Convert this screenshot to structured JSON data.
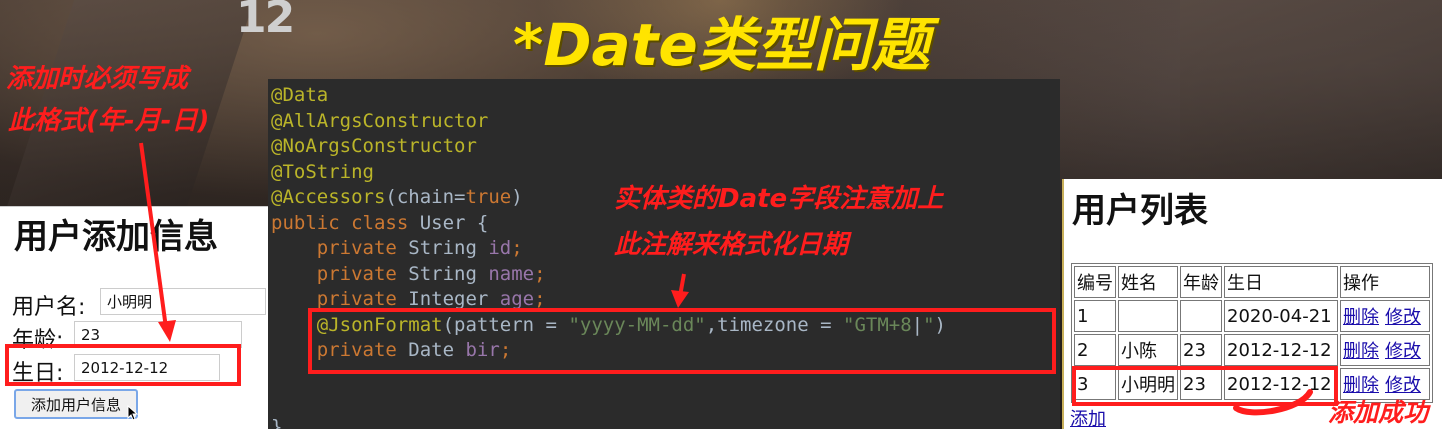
{
  "slide": {
    "page_number": "12",
    "title": "*Date类型问题"
  },
  "annotations": {
    "form_note_line1": "添加时必须写成",
    "form_note_line2": "此格式(年-月-日)",
    "code_note_line1": "实体类的Date字段注意加上",
    "code_note_line2": "此注解来格式化日期",
    "success_note": "添加成功"
  },
  "form": {
    "heading": "用户添加信息",
    "fields": [
      {
        "label": "用户名:",
        "value": "小明明"
      },
      {
        "label": "年龄:",
        "value": "23"
      },
      {
        "label": "生日:",
        "value": "2012-12-12"
      }
    ],
    "submit_label": "添加用户信息"
  },
  "code": {
    "lines": [
      {
        "parts": [
          {
            "t": "@Data",
            "c": "ann"
          }
        ]
      },
      {
        "parts": [
          {
            "t": "@AllArgsConstructor",
            "c": "ann"
          }
        ]
      },
      {
        "parts": [
          {
            "t": "@NoArgsConstructor",
            "c": "ann"
          }
        ]
      },
      {
        "parts": [
          {
            "t": "@ToString",
            "c": "ann"
          }
        ]
      },
      {
        "parts": [
          {
            "t": "@Accessors",
            "c": "ann"
          },
          {
            "t": "(chain=",
            "c": "pl"
          },
          {
            "t": "true",
            "c": "kw"
          },
          {
            "t": ")",
            "c": "pl"
          }
        ]
      },
      {
        "parts": [
          {
            "t": "public class ",
            "c": "kw"
          },
          {
            "t": "User {",
            "c": "pl"
          }
        ]
      },
      {
        "parts": [
          {
            "t": "    private ",
            "c": "kw"
          },
          {
            "t": "String ",
            "c": "pl"
          },
          {
            "t": "id",
            "c": "fld"
          },
          {
            "t": ";",
            "c": "kw"
          }
        ]
      },
      {
        "parts": [
          {
            "t": "    private ",
            "c": "kw"
          },
          {
            "t": "String ",
            "c": "pl"
          },
          {
            "t": "name",
            "c": "fld"
          },
          {
            "t": ";",
            "c": "kw"
          }
        ]
      },
      {
        "parts": [
          {
            "t": "    private ",
            "c": "kw"
          },
          {
            "t": "Integer ",
            "c": "pl"
          },
          {
            "t": "age",
            "c": "fld"
          },
          {
            "t": ";",
            "c": "kw"
          }
        ]
      },
      {
        "parts": [
          {
            "t": "    @JsonFormat",
            "c": "ann"
          },
          {
            "t": "(pattern = ",
            "c": "pl"
          },
          {
            "t": "\"yyyy-MM-dd\"",
            "c": "str"
          },
          {
            "t": ",timezone = ",
            "c": "pl"
          },
          {
            "t": "\"GTM+8",
            "c": "str"
          },
          {
            "t": "|",
            "c": "pl"
          },
          {
            "t": "\"",
            "c": "str"
          },
          {
            "t": ")",
            "c": "pl"
          }
        ]
      },
      {
        "parts": [
          {
            "t": "    private ",
            "c": "kw"
          },
          {
            "t": "Date ",
            "c": "pl"
          },
          {
            "t": "bir",
            "c": "fld"
          },
          {
            "t": ";",
            "c": "kw"
          }
        ]
      },
      {
        "parts": []
      },
      {
        "parts": []
      },
      {
        "parts": [
          {
            "t": "}",
            "c": "pl"
          }
        ]
      }
    ]
  },
  "user_list": {
    "heading": "用户列表",
    "columns": [
      "编号",
      "姓名",
      "年龄",
      "生日",
      "操作"
    ],
    "rows": [
      {
        "id": "1",
        "name": "",
        "age": "",
        "birthday": "2020-04-21"
      },
      {
        "id": "2",
        "name": "小陈",
        "age": "23",
        "birthday": "2012-12-12"
      },
      {
        "id": "3",
        "name": "小明明",
        "age": "23",
        "birthday": "2012-12-12"
      }
    ],
    "delete_label": "删除",
    "edit_label": "修改",
    "add_link": "添加"
  },
  "colors": {
    "title": "#ffe400",
    "annotation": "#ff1d1d",
    "code_background": "#2b2b2b",
    "link": "#1a0dab"
  }
}
